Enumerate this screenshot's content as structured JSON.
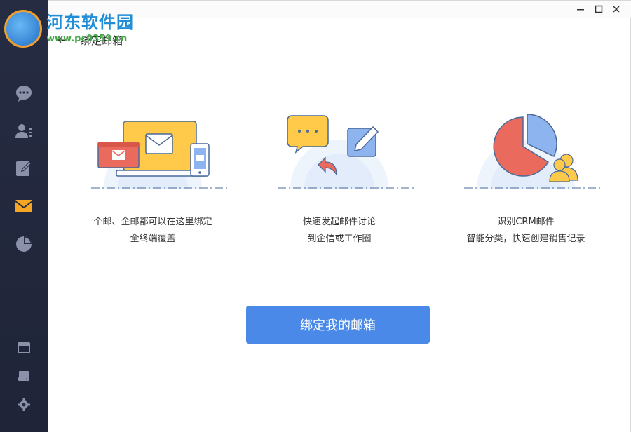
{
  "watermark": {
    "title": "河东软件园",
    "url": "www.pc0359.cn"
  },
  "sidebar": {
    "items": [
      {
        "icon": "chat-bubble-icon",
        "label": "消息"
      },
      {
        "icon": "contacts-icon",
        "label": "联系人"
      },
      {
        "icon": "edit-icon",
        "label": "笔记"
      },
      {
        "icon": "mail-icon",
        "label": "邮件"
      },
      {
        "icon": "pie-chart-icon",
        "label": "报表"
      }
    ],
    "bottom_items": [
      {
        "icon": "window-icon"
      },
      {
        "icon": "storage-icon"
      },
      {
        "icon": "settings-icon"
      }
    ],
    "active_index": 3,
    "active_color": "#f5a623"
  },
  "window_controls": {
    "minimize": "—",
    "maximize": "□",
    "close": "✕"
  },
  "header": {
    "back": "←",
    "title": "绑定邮箱"
  },
  "features": [
    {
      "line1": "个邮、企邮都可以在这里绑定",
      "line2": "全终端覆盖"
    },
    {
      "line1": "快速发起邮件讨论",
      "line2": "到企信或工作圈"
    },
    {
      "line1": "识别CRM邮件",
      "line2": "智能分类，快速创建销售记录"
    }
  ],
  "bind_button": {
    "label": "绑定我的邮箱",
    "color": "#4a89e8"
  }
}
